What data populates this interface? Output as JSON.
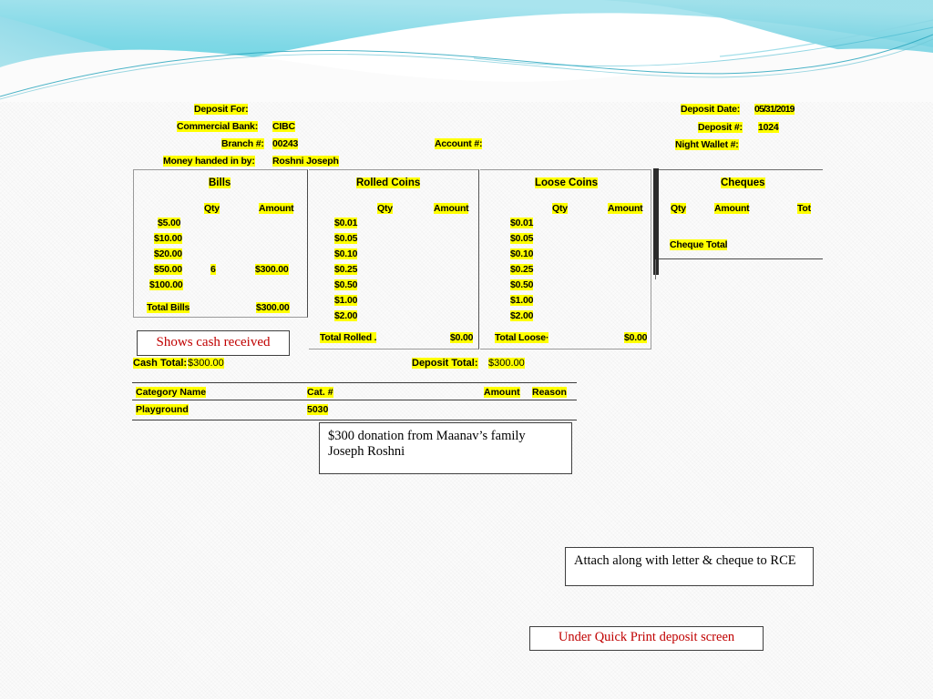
{
  "banner": {
    "name": "wave-banner",
    "color_top": "#6ad0e2",
    "color_mid": "#9adfe8",
    "color_accent": "#2fb4cf"
  },
  "header_left": {
    "deposit_for_label": "Deposit For:",
    "commercial_bank_label": "Commercial Bank:",
    "commercial_bank_value": "CIBC",
    "branch_label": "Branch #:",
    "branch_value": "00243",
    "money_handed_label": "Money handed in by:",
    "money_handed_value": "Roshni Joseph",
    "account_label": "Account #:",
    "account_value": ""
  },
  "header_right": {
    "deposit_date_label": "Deposit Date:",
    "deposit_date_value": "05/31/2019",
    "deposit_num_label": "Deposit #:",
    "deposit_num_value": "1024",
    "night_wallet_label": "Night Wallet #:",
    "night_wallet_value": ""
  },
  "bills": {
    "title": "Bills",
    "col_qty": "Qty",
    "col_amount": "Amount",
    "rows": [
      {
        "denom": "$5.00",
        "qty": "",
        "amount": ""
      },
      {
        "denom": "$10.00",
        "qty": "",
        "amount": ""
      },
      {
        "denom": "$20.00",
        "qty": "",
        "amount": ""
      },
      {
        "denom": "$50.00",
        "qty": "6",
        "amount": "$300.00"
      },
      {
        "denom": "$100.00",
        "qty": "",
        "amount": ""
      }
    ],
    "total_label": "Total Bills",
    "total_value": "$300.00"
  },
  "rolled_coins": {
    "title": "Rolled Coins",
    "col_qty": "Qty",
    "col_amount": "Amount",
    "rows": [
      {
        "denom": "$0.01",
        "qty": "",
        "amount": ""
      },
      {
        "denom": "$0.05",
        "qty": "",
        "amount": ""
      },
      {
        "denom": "$0.10",
        "qty": "",
        "amount": ""
      },
      {
        "denom": "$0.25",
        "qty": "",
        "amount": ""
      },
      {
        "denom": "$0.50",
        "qty": "",
        "amount": ""
      },
      {
        "denom": "$1.00",
        "qty": "",
        "amount": ""
      },
      {
        "denom": "$2.00",
        "qty": "",
        "amount": ""
      }
    ],
    "total_label": "Total Rolled .",
    "total_value": "$0.00"
  },
  "loose_coins": {
    "title": "Loose Coins",
    "col_qty": "Qty",
    "col_amount": "Amount",
    "rows": [
      {
        "denom": "$0.01",
        "qty": "",
        "amount": ""
      },
      {
        "denom": "$0.05",
        "qty": "",
        "amount": ""
      },
      {
        "denom": "$0.10",
        "qty": "",
        "amount": ""
      },
      {
        "denom": "$0.25",
        "qty": "",
        "amount": ""
      },
      {
        "denom": "$0.50",
        "qty": "",
        "amount": ""
      },
      {
        "denom": "$1.00",
        "qty": "",
        "amount": ""
      },
      {
        "denom": "$2.00",
        "qty": "",
        "amount": ""
      }
    ],
    "total_label": "Total Loose·",
    "total_value": "$0.00"
  },
  "cheques": {
    "title": "Cheques",
    "col_qty": "Qty",
    "col_amount": "Amount",
    "col_total_clipped": "Tot",
    "total_label": "Cheque Total",
    "total_value": ""
  },
  "totals": {
    "cash_total_label": "Cash Total:",
    "cash_total_value": "$300.00",
    "deposit_total_label": "Deposit Total:",
    "deposit_total_value": "$300.00"
  },
  "category_table": {
    "headers": [
      "Category Name",
      "Cat. #",
      "Amount",
      "Reason"
    ],
    "rows": [
      {
        "name": "Playground",
        "cat_num": "5030",
        "amount": "",
        "reason": ""
      }
    ]
  },
  "callouts": {
    "cash_received": "Shows cash received",
    "donation_note": "$300 donation from Maanav’s family\nJoseph Roshni",
    "attach_note": "Attach along with letter & cheque to RCE",
    "quick_print": "Under Quick Print deposit screen"
  },
  "colors": {
    "highlight": "#FFFF00",
    "red_text": "#C00000",
    "rule": "#3c3c3c"
  }
}
